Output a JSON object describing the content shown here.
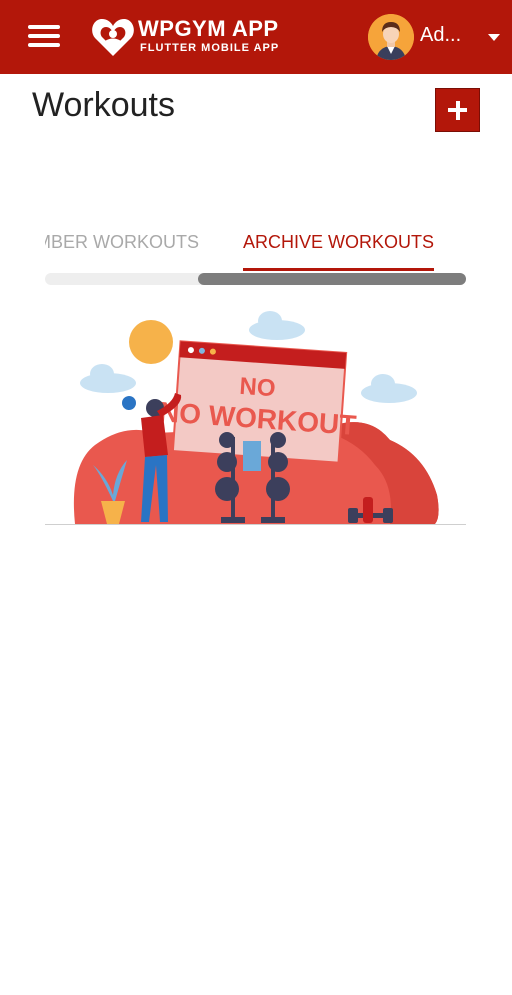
{
  "app": {
    "brand_title": "WPGYM APP",
    "brand_subtitle": "FLUTTER MOBILE APP",
    "user_name": "Ad...",
    "accent_color": "#b3170a"
  },
  "icons": {
    "menu": "hamburger-menu-icon",
    "logo": "heart-logo-icon",
    "avatar": "user-avatar",
    "dropdown": "caret-down-icon",
    "add": "plus-icon"
  },
  "page": {
    "title": "Workouts",
    "add_button_label": "+"
  },
  "tabs": [
    {
      "label": "MEMBER WORKOUTS",
      "selected": false
    },
    {
      "label": "ARCHIVE WORKOUTS",
      "selected": true
    }
  ],
  "empty_state": {
    "illustration_text": "NO WORKOUT"
  }
}
